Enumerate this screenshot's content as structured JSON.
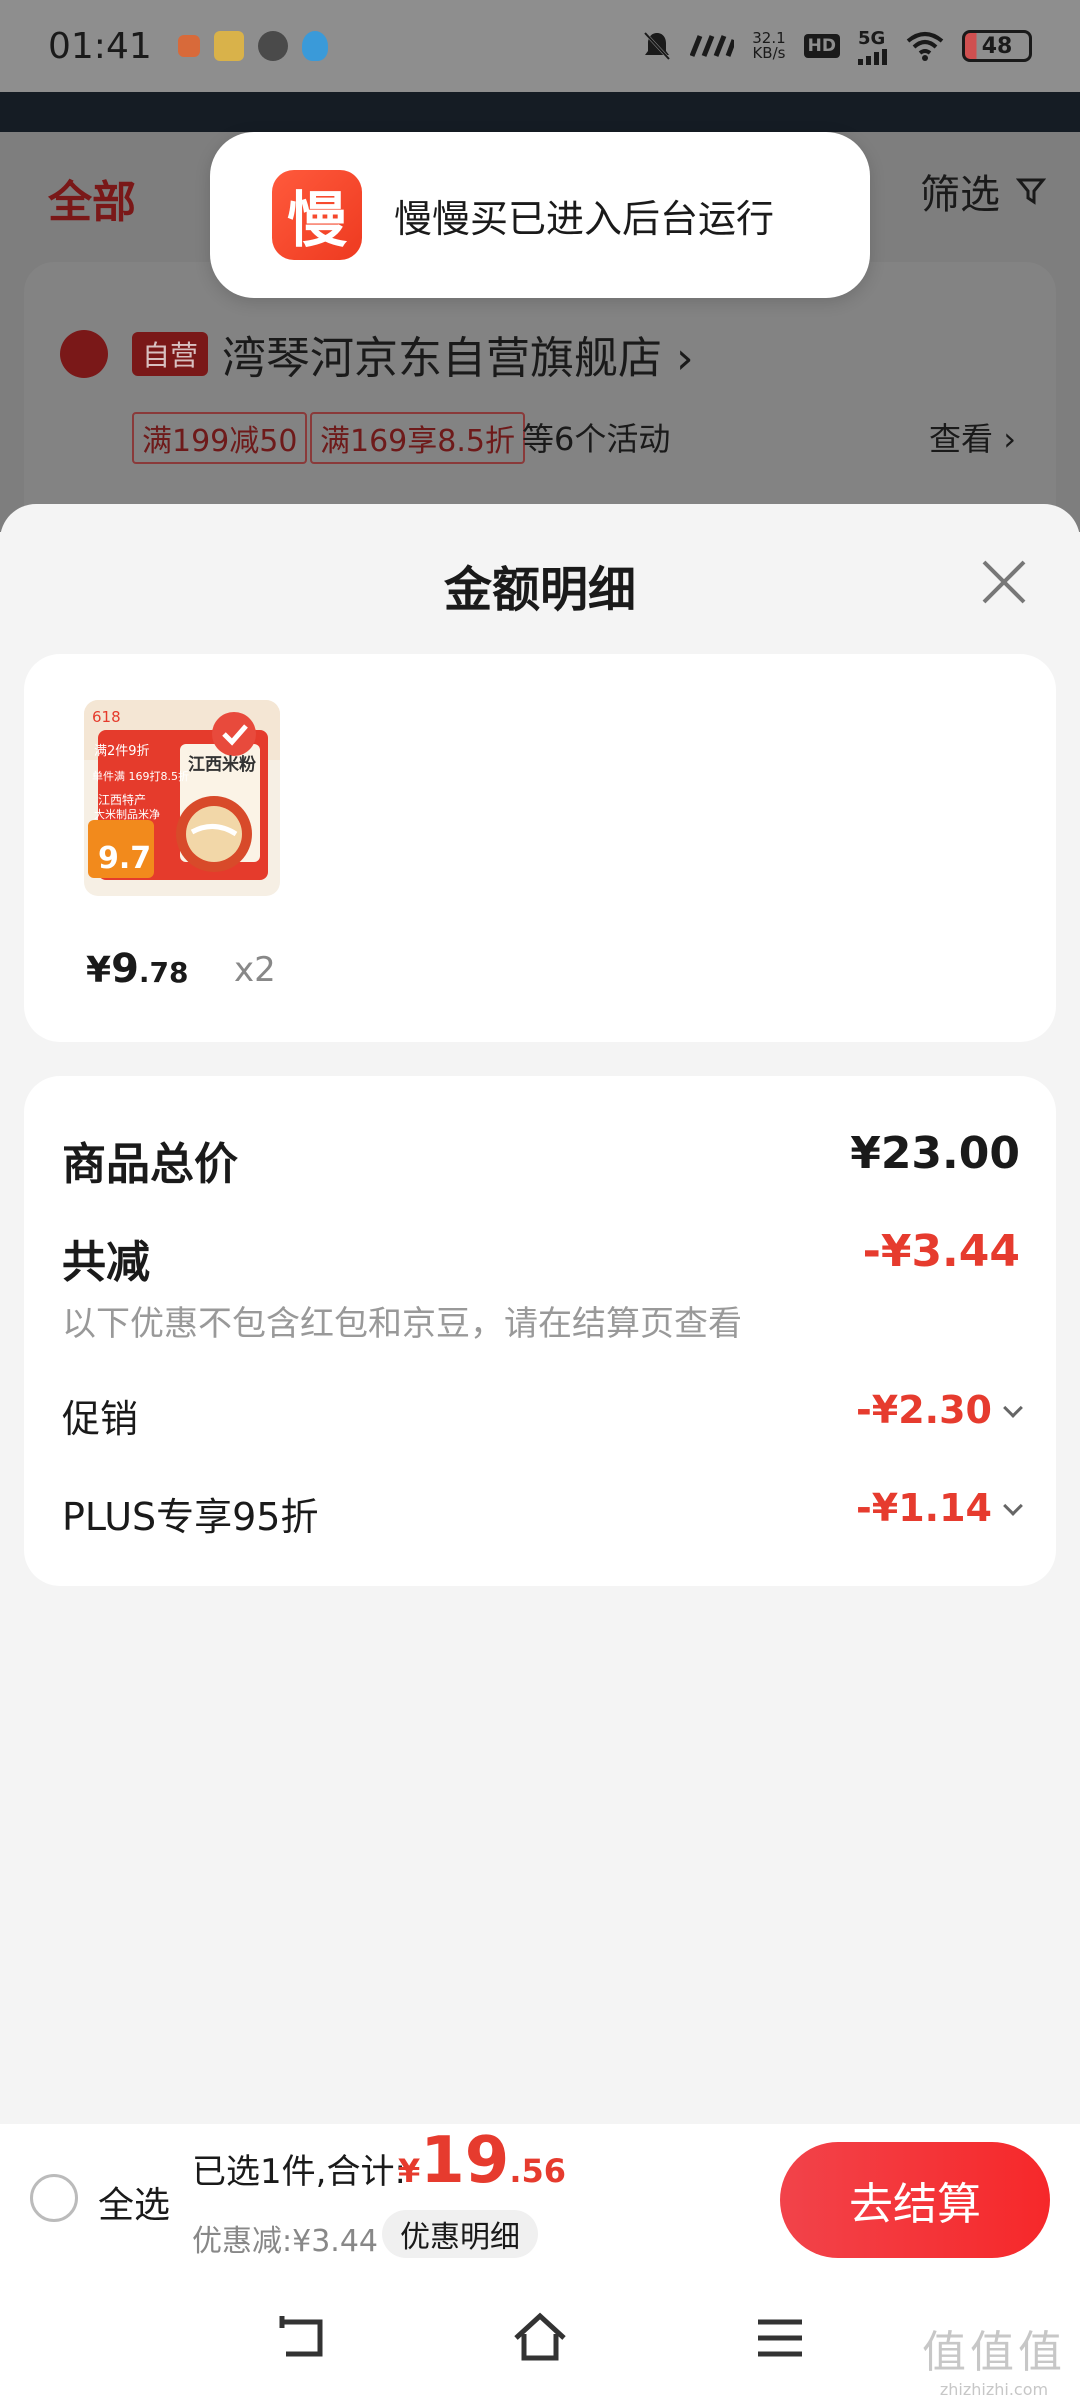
{
  "status_bar": {
    "time": "01:41",
    "net_speed": "32.1",
    "net_unit": "KB/s",
    "hd": "HD",
    "network": "5G",
    "battery": "48",
    "icons": [
      "notification-orange-icon",
      "app-yellow-icon",
      "app-zhi-icon",
      "qq-icon",
      "mute-icon",
      "wifi-icon",
      "signal-icon"
    ]
  },
  "background_page": {
    "tab_all": "全部",
    "filter_label": "筛选",
    "store_tag": "自营",
    "store_name": "湾琴河京东自营旗舰店",
    "promo_1": "满199减50",
    "promo_2": "满169享8.5折",
    "promo_more": "等6个活动",
    "view_label": "查看"
  },
  "toast": {
    "icon_char": "慢",
    "text": "慢慢买已进入后台运行"
  },
  "sheet": {
    "title": "金额明细",
    "item": {
      "price_symbol": "¥",
      "price_int": "9",
      "price_dec": ".78",
      "quantity": "x2",
      "image_texts": {
        "badge": "618",
        "promo_top": "满2件9折",
        "promo_mid": "单件满\n169打8.5折",
        "origin": "江西特产",
        "desc": "大米制品米净",
        "title": "江西米粉",
        "price": "9.7"
      }
    },
    "totals": {
      "goods_total_label": "商品总价",
      "goods_total_value": "¥23.00",
      "reduced_label": "共减",
      "reduced_value": "-¥3.44",
      "note": "以下优惠不包含红包和京豆，请在结算页查看",
      "promo_label": "促销",
      "promo_value": "-¥2.30",
      "plus_label": "PLUS专享95折",
      "plus_value": "-¥1.14"
    }
  },
  "checkout": {
    "select_all": "全选",
    "selected_text": "已选1件,合计:",
    "total_symbol": "¥",
    "total_int": "19",
    "total_dec": ".56",
    "discount_text": "优惠减:¥3.44",
    "detail_button": "优惠明细",
    "submit_button": "去结算"
  },
  "watermark": {
    "glyphs": "值值值",
    "url": "zhizhizhi.com"
  },
  "colors": {
    "accent_red": "#e63b2e",
    "submit_red": "#f6282a",
    "toast_orange": "#ff5a3c"
  }
}
